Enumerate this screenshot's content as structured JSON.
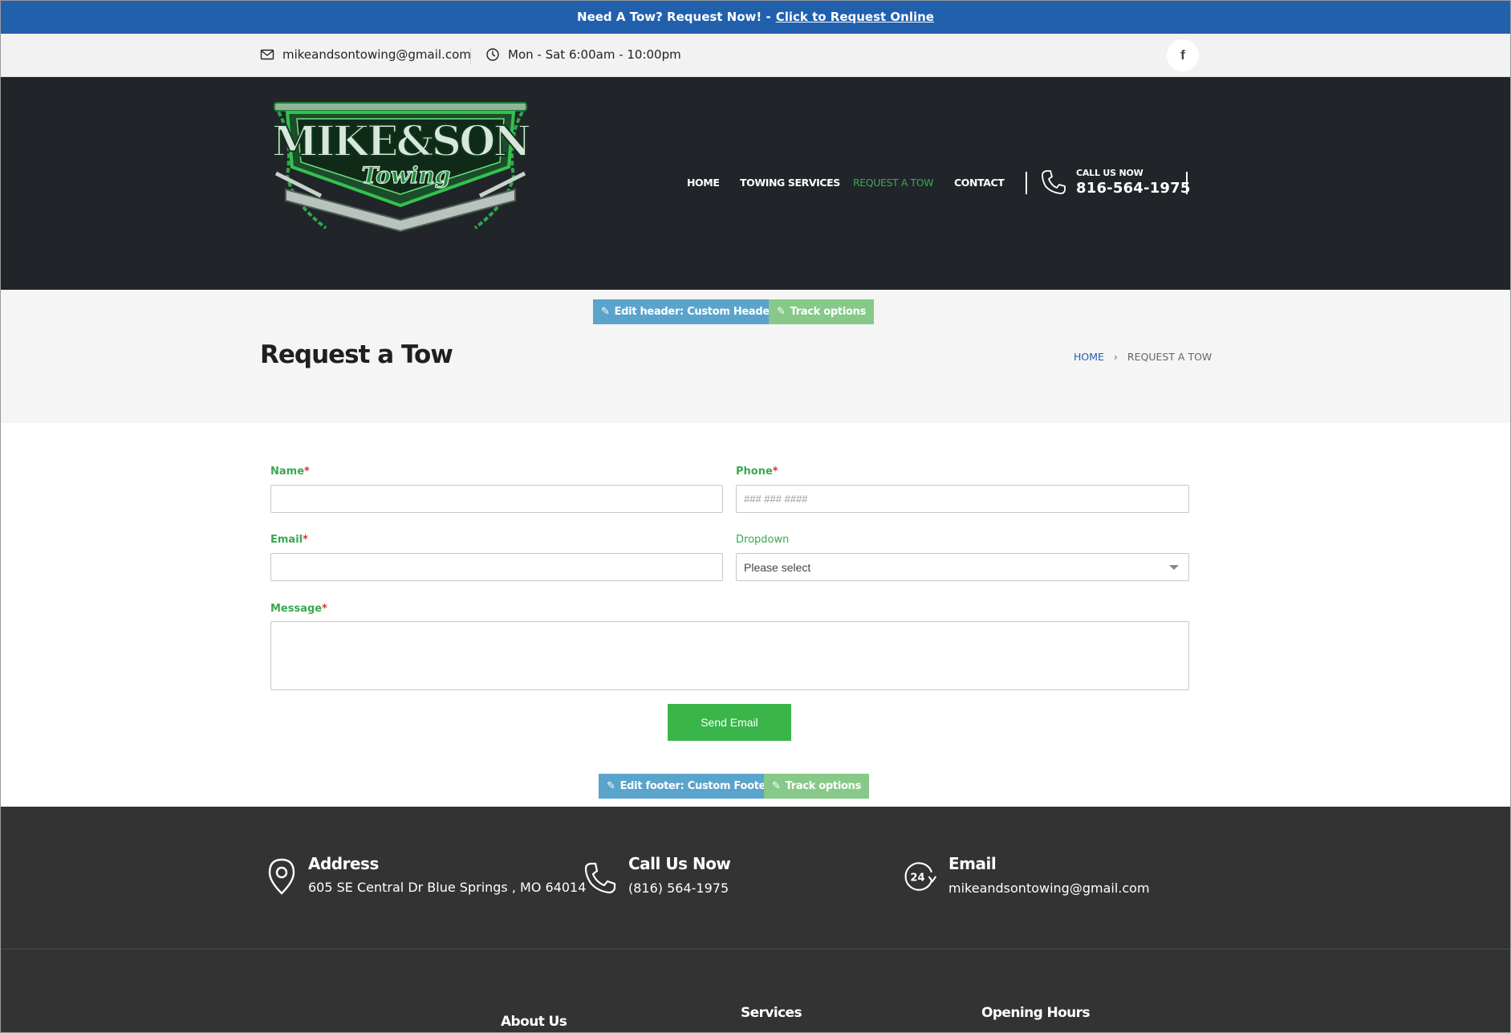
{
  "topbar": {
    "prefix": "Need A Tow? Request Now! -",
    "link": "Click to Request Online"
  },
  "infobar": {
    "email": "mikeandsontowing@gmail.com",
    "hours": "Mon - Sat 6:00am - 10:00pm",
    "social_icon": "f"
  },
  "header": {
    "logo_alt": "MIKE & SON Towing",
    "nav": [
      "HOME",
      "TOWING SERVICES",
      "REQUEST A TOW",
      "CONTACT"
    ],
    "active_nav": "REQUEST A TOW",
    "call_label": "CALL US NOW",
    "call_number": "816-564-1975"
  },
  "admin": {
    "edit_header": "Edit header: Custom Header",
    "track_options": "Track options",
    "edit_footer": "Edit footer: Custom Footer"
  },
  "page": {
    "title": "Request a Tow",
    "breadcrumb_home": "HOME",
    "breadcrumb_sep": "›",
    "breadcrumb_current": "REQUEST A TOW"
  },
  "form": {
    "name_label": "Name",
    "phone_label": "Phone",
    "phone_placeholder": "### ### ####",
    "email_label": "Email",
    "dropdown_label": "Dropdown",
    "dropdown_value": "Please select",
    "message_label": "Message",
    "required_mark": "*",
    "submit": "Send Email"
  },
  "footer": {
    "address_title": "Address",
    "address_text": "605 SE Central Dr Blue Springs , MO 64014",
    "call_title": "Call Us Now",
    "call_text": "(816) 564-1975",
    "email_title": "Email",
    "email_text": "mikeandsontowing@gmail.com",
    "about": "About Us",
    "services": "Services",
    "hours": "Opening Hours",
    "badge_24": "24"
  },
  "colors": {
    "brand_blue": "#2160ad",
    "accent_green": "#3ab54a",
    "header_dark": "#212529",
    "footer_dark": "#333333"
  }
}
